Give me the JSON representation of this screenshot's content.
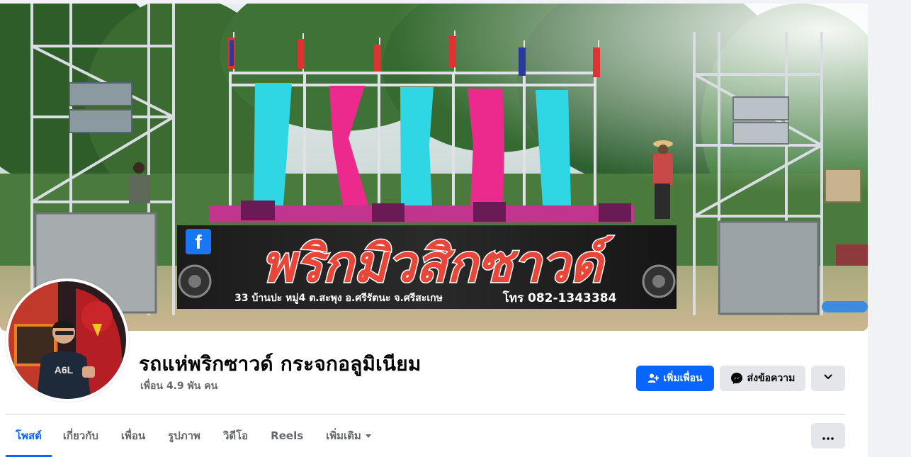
{
  "profile": {
    "name": "รถแห่พริกซาวด์ กระจกอลูมิเนียม",
    "friends_count": "เพื่อน 4.9 พัน คน"
  },
  "cover": {
    "banner_title": "พริกมิวสิกซาวด์",
    "banner_address": "33 บ้านปะ หมู่4 ต.สะพุง อ.ศรีรัตนะ จ.ศรีสะเกษ",
    "banner_phone": "โทร 082-1343384"
  },
  "actions": {
    "add_friend": "เพิ่มเพื่อน",
    "message": "ส่งข้อความ"
  },
  "tabs": [
    {
      "label": "โพสต์"
    },
    {
      "label": "เกี่ยวกับ"
    },
    {
      "label": "เพื่อน"
    },
    {
      "label": "รูปภาพ"
    },
    {
      "label": "วิดีโอ"
    },
    {
      "label": "Reels"
    },
    {
      "label": "เพิ่มเติม"
    }
  ],
  "colors": {
    "primary": "#0866ff",
    "secondary_bg": "#e4e6eb",
    "muted_text": "#65676b"
  }
}
